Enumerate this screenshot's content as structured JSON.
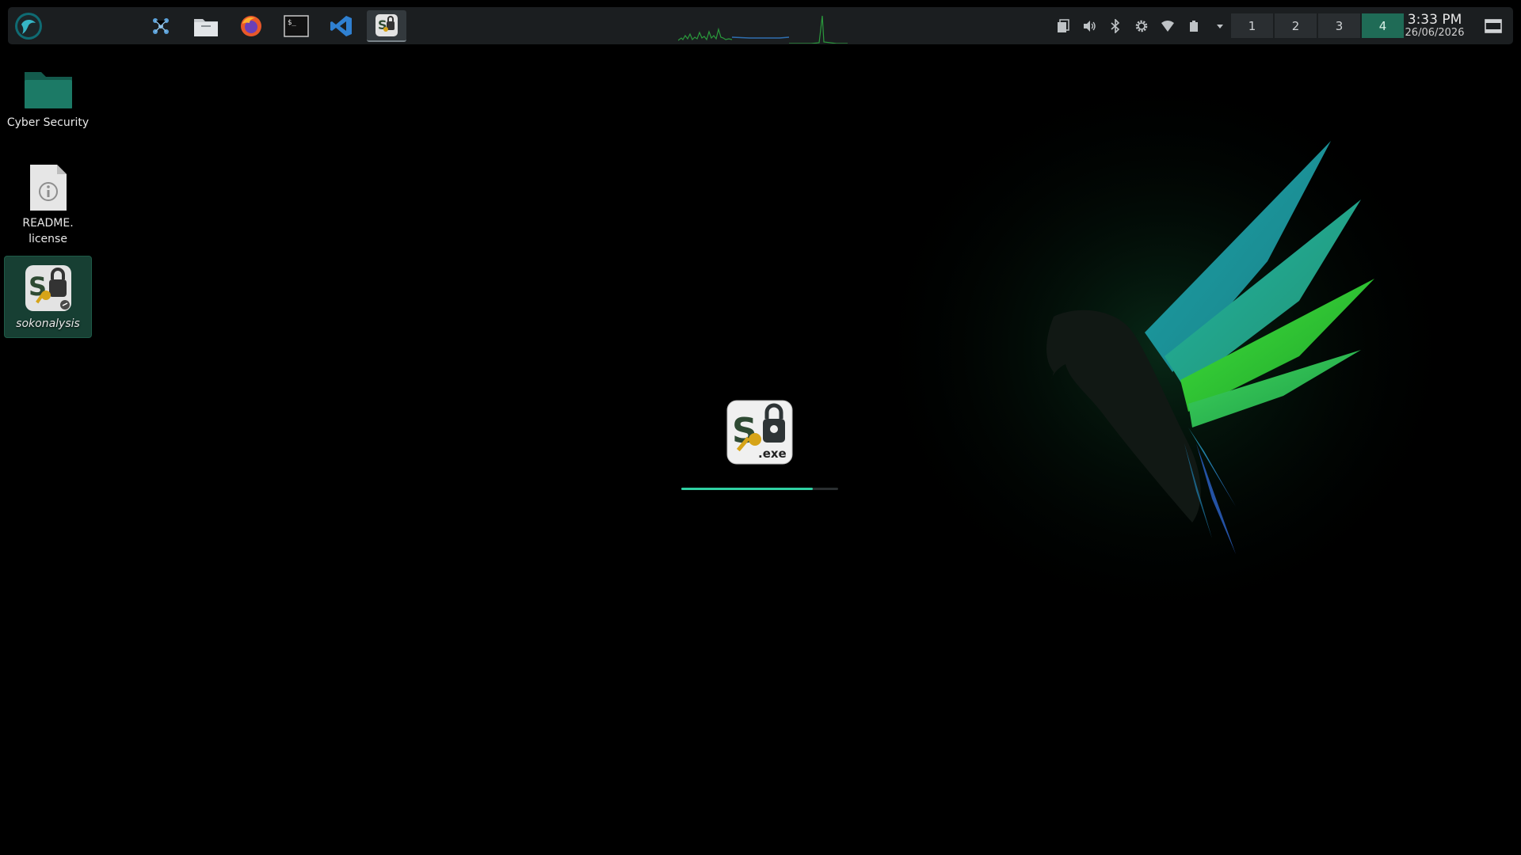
{
  "panel": {
    "launcher_icon": "parrot-logo-icon",
    "tasks": [
      {
        "name": "network-tool-icon",
        "active": false
      },
      {
        "name": "file-manager-icon",
        "active": false
      },
      {
        "name": "firefox-icon",
        "active": false
      },
      {
        "name": "terminal-icon",
        "active": false
      },
      {
        "name": "vscode-icon",
        "active": false
      },
      {
        "name": "sokonalysis-icon",
        "active": true
      }
    ],
    "tray": [
      "clipboard-icon",
      "volume-icon",
      "bluetooth-icon",
      "settings-icon",
      "wifi-icon",
      "battery-icon",
      "tray-expand-icon"
    ],
    "workspaces": [
      "1",
      "2",
      "3",
      "4"
    ],
    "active_workspace": "4",
    "clock": {
      "time": "3:33 PM",
      "date": "26/06/2026"
    }
  },
  "desktop_icons": [
    {
      "label": "Cyber Security",
      "icon": "folder-icon"
    },
    {
      "label": "README.",
      "label2": "license",
      "icon": "info-file-icon"
    },
    {
      "label": "sokonalysis",
      "icon": "sokonalysis-icon"
    }
  ],
  "splash": {
    "icon_text_s": "S",
    "icon_text_ext": ".exe",
    "progress": 0.84
  },
  "colors": {
    "accent": "#2fd1a3",
    "workspace_active": "#1f6b56",
    "panel_bg": "#1b1e20"
  }
}
